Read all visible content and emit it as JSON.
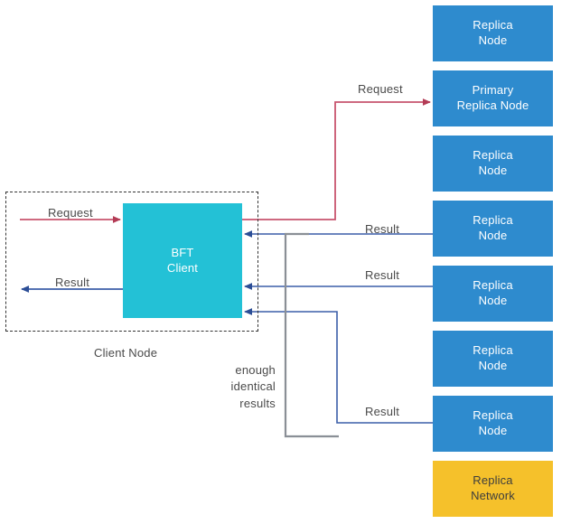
{
  "diagram": {
    "title": "BFT Client and Replica Network request/result flow",
    "colors": {
      "replica_node_fill": "#2e8bce",
      "replica_network_fill": "#f5c12b",
      "bft_client_fill": "#23c1d6",
      "request_arrow": "#c8546e",
      "result_arrow": "#3b5ea8",
      "bracket": "#8a8f96",
      "dashed_border": "#333333",
      "label_text": "#4a4a4a",
      "background": "#ffffff"
    },
    "client": {
      "box_label_line1": "BFT",
      "box_label_line2": "Client",
      "group_caption": "Client Node"
    },
    "bracket": {
      "label_line1": "enough",
      "label_line2": "identical",
      "label_line3": "results"
    },
    "labels": {
      "request_in": "Request",
      "result_out": "Result",
      "request_to_primary": "Request",
      "result_1": "Result",
      "result_2": "Result",
      "result_3": "Result"
    },
    "nodes": [
      {
        "id": "replica-node-1",
        "line1": "Replica",
        "line2": "Node",
        "kind": "replica"
      },
      {
        "id": "primary-replica-node",
        "line1": "Primary",
        "line2": "Replica Node",
        "kind": "replica"
      },
      {
        "id": "replica-node-2",
        "line1": "Replica",
        "line2": "Node",
        "kind": "replica"
      },
      {
        "id": "replica-node-3",
        "line1": "Replica",
        "line2": "Node",
        "kind": "replica"
      },
      {
        "id": "replica-node-4",
        "line1": "Replica",
        "line2": "Node",
        "kind": "replica"
      },
      {
        "id": "replica-node-5",
        "line1": "Replica",
        "line2": "Node",
        "kind": "replica"
      },
      {
        "id": "replica-node-6",
        "line1": "Replica",
        "line2": "Node",
        "kind": "replica"
      },
      {
        "id": "replica-network",
        "line1": "Replica",
        "line2": "Network",
        "kind": "network"
      }
    ]
  }
}
